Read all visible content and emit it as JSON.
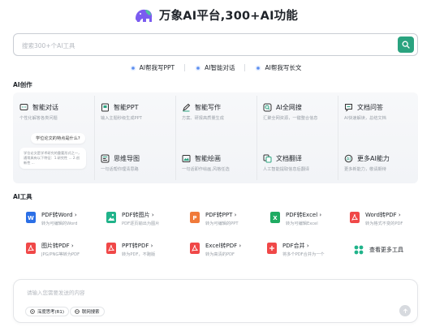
{
  "header": {
    "title": "万象AI平台,300+AI功能",
    "logo_icon": "elephant-logo-icon"
  },
  "search": {
    "placeholder": "搜索300+个AI工具",
    "button_icon": "search-icon"
  },
  "quick_links": [
    {
      "label": "AI帮我写PPT"
    },
    {
      "label": "AI智能对话"
    },
    {
      "label": "AI帮我写长文"
    }
  ],
  "ai_create": {
    "title": "AI创作",
    "cards": [
      {
        "title": "智能对话",
        "desc": "个性化解答各类问题",
        "icon": "chat-icon"
      },
      {
        "title": "智能PPT",
        "desc": "输入主题秒级生成PPT",
        "icon": "ppt-icon"
      },
      {
        "title": "智能写作",
        "desc": "方案、研报高质量生成",
        "icon": "pen-icon"
      },
      {
        "title": "AI全网搜",
        "desc": "汇聚全网资源，一键整合信息",
        "icon": "search-globe-icon"
      },
      {
        "title": "文档问答",
        "desc": "AI快速解读，总结文档",
        "icon": "doc-qa-icon"
      },
      {
        "title": "思维导图",
        "desc": "一句话帮你理清思路",
        "icon": "mindmap-icon"
      },
      {
        "title": "智能绘画",
        "desc": "一句话即作绘画,风格任选",
        "icon": "paint-icon"
      },
      {
        "title": "文档翻译",
        "desc": "人工智能提取信息后翻译",
        "icon": "translate-icon"
      },
      {
        "title": "更多AI能力",
        "desc": "更多新能力，敬请期待",
        "icon": "more-ai-icon"
      }
    ],
    "preview": {
      "question": "学位论文的特点是什么?",
      "answer": "学位论文是学术研究的重要形式之一，通常具有以下特征：1.研究性 ... 2.创新性 ..."
    }
  },
  "ai_tools": {
    "title": "AI工具",
    "items": [
      {
        "title": "PDF转Word",
        "desc": "转为可编辑的Word",
        "icon": "word-icon",
        "color": "#2b6fe6"
      },
      {
        "title": "PDF转图片",
        "desc": "PDF逐页输出为图片",
        "icon": "image-icon",
        "color": "#20b38a"
      },
      {
        "title": "PDF转PPT",
        "desc": "转为可编辑的PPT",
        "icon": "ppt-file-icon",
        "color": "#f07a3a"
      },
      {
        "title": "PDF转Excel",
        "desc": "转为可编辑Excel",
        "icon": "excel-icon",
        "color": "#1fab62"
      },
      {
        "title": "Word转PDF",
        "desc": "转为格式不变的PDF",
        "icon": "pdf-icon",
        "color": "#f04848"
      },
      {
        "title": "图片转PDF",
        "desc": "JPG/PNG等转为PDF",
        "icon": "pdf-icon",
        "color": "#f04848"
      },
      {
        "title": "PPT转PDF",
        "desc": "转为PDF，不跑版",
        "icon": "pdf-icon",
        "color": "#f04848"
      },
      {
        "title": "Excel转PDF",
        "desc": "转为高清的PDF",
        "icon": "pdf-icon",
        "color": "#f04848"
      },
      {
        "title": "PDF合并",
        "desc": "将多个PDF合并为一个",
        "icon": "merge-icon",
        "color": "#f04848"
      },
      {
        "title": "查看更多工具",
        "desc": "",
        "icon": "grid-more-icon",
        "color": "#20b38a"
      }
    ]
  },
  "chat_input": {
    "placeholder": "请输入您需要发送的内容",
    "chip_deep": "深度思考(R1)",
    "chip_web": "联网搜索",
    "send_icon": "send-arrow-icon"
  }
}
